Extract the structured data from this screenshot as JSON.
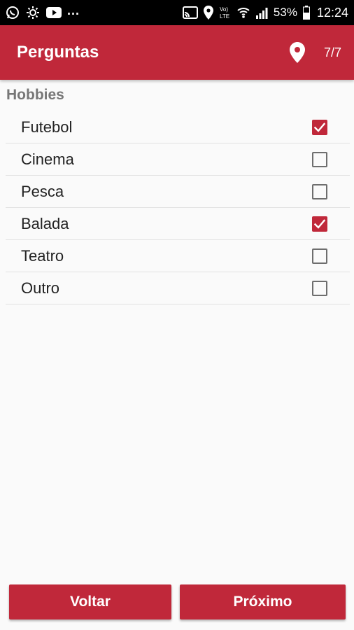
{
  "status_bar": {
    "icons_left": [
      "whatsapp-icon",
      "cast-icon",
      "youtube-icon"
    ],
    "overflow": "...",
    "icons_right": [
      "screen-cast-icon",
      "location-icon",
      "volte-icon",
      "wifi-icon",
      "signal-icon"
    ],
    "volte_label": "Vo) LTE",
    "battery": "53%",
    "time": "12:24"
  },
  "app_bar": {
    "title": "Perguntas",
    "counter": "7/7",
    "background": "#c0283a"
  },
  "section": {
    "title": "Hobbies"
  },
  "options": [
    {
      "label": "Futebol",
      "checked": true
    },
    {
      "label": "Cinema",
      "checked": false
    },
    {
      "label": "Pesca",
      "checked": false
    },
    {
      "label": "Balada",
      "checked": true
    },
    {
      "label": "Teatro",
      "checked": false
    },
    {
      "label": "Outro",
      "checked": false
    }
  ],
  "footer": {
    "back_label": "Voltar",
    "next_label": "Próximo"
  }
}
